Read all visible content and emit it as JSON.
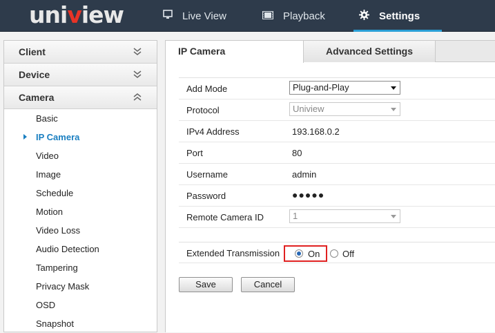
{
  "header": {
    "brand": "uniview",
    "nav": [
      {
        "label": "Live View",
        "icon": "monitor-icon"
      },
      {
        "label": "Playback",
        "icon": "film-icon"
      },
      {
        "label": "Settings",
        "icon": "gear-icon"
      }
    ]
  },
  "sidebar": {
    "sections": [
      {
        "label": "Client",
        "state": "collapsed"
      },
      {
        "label": "Device",
        "state": "collapsed"
      },
      {
        "label": "Camera",
        "state": "expanded"
      }
    ],
    "camera_items": [
      "Basic",
      "IP Camera",
      "Video",
      "Image",
      "Schedule",
      "Motion",
      "Video Loss",
      "Audio Detection",
      "Tampering",
      "Privacy Mask",
      "OSD",
      "Snapshot"
    ],
    "active_item": "IP Camera"
  },
  "tabs": [
    {
      "label": "IP Camera",
      "active": true
    },
    {
      "label": "Advanced Settings",
      "active": false
    }
  ],
  "form": {
    "add_mode": {
      "label": "Add Mode",
      "value": "Plug-and-Play"
    },
    "protocol": {
      "label": "Protocol",
      "value": "Uniview"
    },
    "ipv4": {
      "label": "IPv4 Address",
      "value": "193.168.0.2"
    },
    "port": {
      "label": "Port",
      "value": "80"
    },
    "username": {
      "label": "Username",
      "value": "admin"
    },
    "password": {
      "label": "Password",
      "value": "●●●●●"
    },
    "remote_id": {
      "label": "Remote Camera ID",
      "value": "1"
    },
    "ext": {
      "label": "Extended Transmission",
      "on_label": "On",
      "off_label": "Off",
      "selected": "On"
    }
  },
  "buttons": {
    "save": "Save",
    "cancel": "Cancel"
  },
  "colors": {
    "topbar": "#2e3b4b",
    "accent": "#2a9fd6",
    "highlight": "#e02020",
    "brand_dot": "#e83326"
  }
}
